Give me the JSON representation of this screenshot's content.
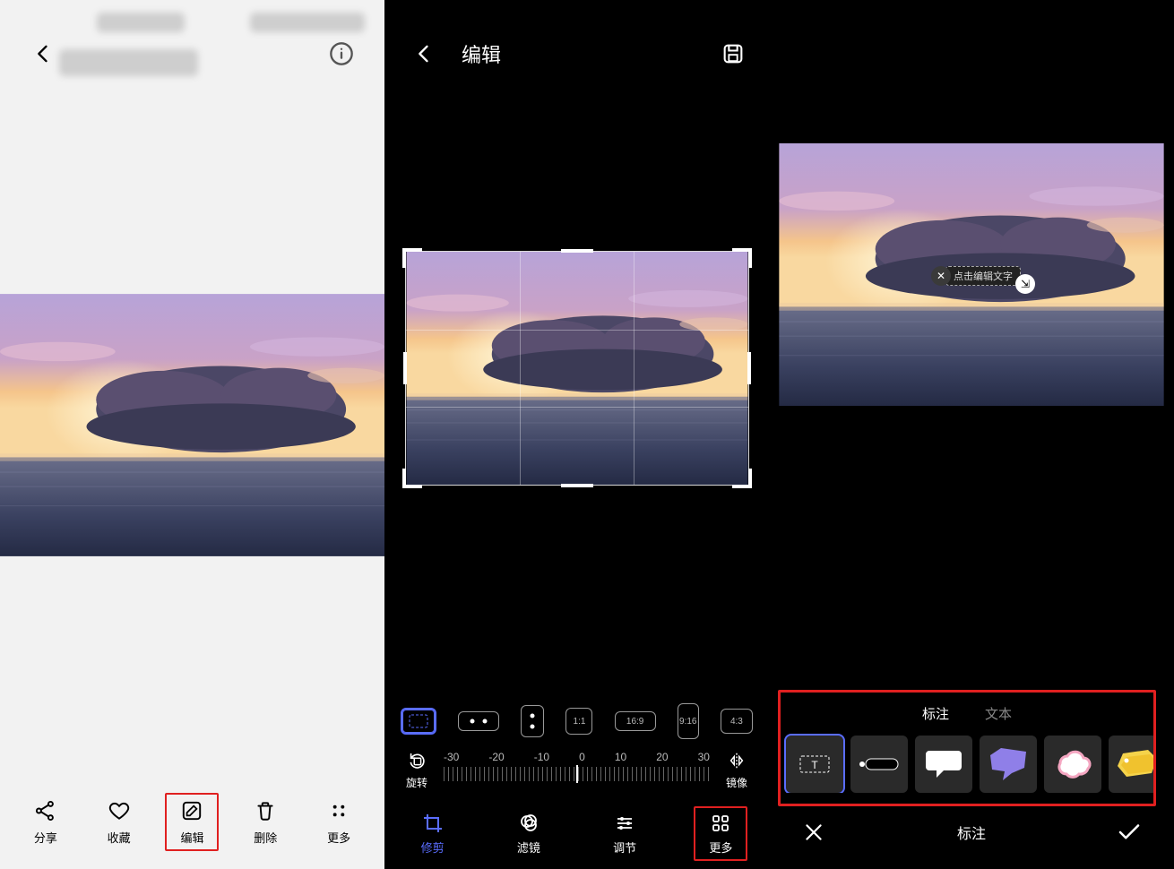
{
  "pane1": {
    "bottom_buttons": {
      "share": "分享",
      "favorite": "收藏",
      "edit": "编辑",
      "delete": "删除",
      "more": "更多"
    }
  },
  "pane2": {
    "title": "编辑",
    "aspect_ratios": [
      "free",
      "wide",
      "tall",
      "1:1",
      "16:9",
      "9:16",
      "4:3"
    ],
    "aspect_labels": {
      "oneone": "1:1",
      "sixteen": "16:9",
      "nine": "9:16",
      "four": "4:3"
    },
    "rotation": {
      "left_label": "旋转",
      "right_label": "镜像",
      "ticks": [
        "-30",
        "-20",
        "-10",
        "0",
        "10",
        "20",
        "30"
      ]
    },
    "tools": {
      "crop": "修剪",
      "filter": "滤镜",
      "adjust": "调节",
      "more": "更多"
    }
  },
  "pane3": {
    "bubble_text": "点击编辑文字",
    "tabs": {
      "annotate": "标注",
      "text": "文本"
    },
    "apply_label": "标注",
    "sticker_names": [
      "text-box",
      "arrow-label",
      "speech-bubble",
      "purple-bubble",
      "cloud-bubble",
      "price-tag"
    ]
  }
}
